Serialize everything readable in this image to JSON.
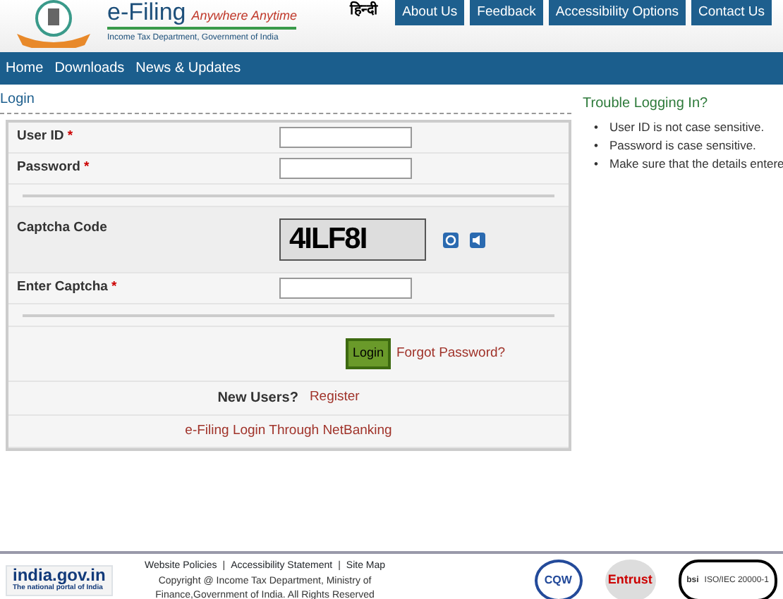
{
  "header": {
    "title": "e-Filing",
    "tagline": "Anywhere Anytime",
    "subtitle": "Income Tax Department, Government of India",
    "language_link": "हिन्दी",
    "top_links": [
      "About Us",
      "Feedback",
      "Accessibility Options",
      "Contact Us"
    ]
  },
  "nav": [
    "Home",
    "Downloads",
    "News & Updates"
  ],
  "login_title": "Login",
  "form": {
    "rows": [
      {
        "kind": "input",
        "label": "User ID",
        "required_mark": "*"
      },
      {
        "kind": "input",
        "label": "Password",
        "required_mark": "*"
      },
      {
        "kind": "divider"
      },
      {
        "kind": "captcha",
        "label": "Captcha Code",
        "captcha": "4ILF8I"
      },
      {
        "kind": "input",
        "label": "Enter Captcha",
        "required_mark": "*"
      },
      {
        "kind": "divider"
      }
    ],
    "login_button": "Login",
    "forgot_link": "Forgot Password?",
    "new_users_label": "New Users?",
    "register_link": "Register",
    "netbanking_link": "e-Filing Login Through NetBanking"
  },
  "help": {
    "title": "Trouble Logging In?",
    "bullet": "•",
    "tips": [
      "User ID is not case sensitive.",
      "Password is case sensitive.",
      "Make sure that the details entere"
    ]
  },
  "footer": {
    "links": [
      "Website Policies",
      "Accessibility Statement",
      "Site Map"
    ],
    "separator": "|",
    "copyright": "Copyright @ Income Tax Department, Ministry of Finance,Government of India. All Rights Reserved",
    "portal": "india.gov.in",
    "portal_caption": "The national portal of India",
    "cqw": "CQW",
    "entrust": "Entrust",
    "bsi": "bsi",
    "iso": "ISO/IEC 20000-1"
  }
}
